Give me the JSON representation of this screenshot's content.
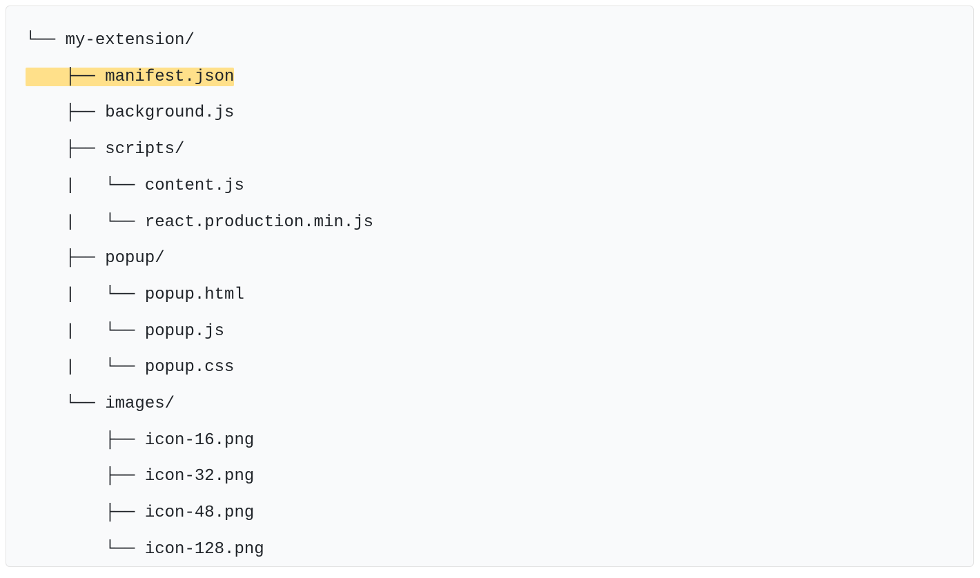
{
  "lines": [
    {
      "prefix": "└── ",
      "label": "my-extension/",
      "highlight": false
    },
    {
      "prefix": "    ├── ",
      "label": "manifest.json",
      "highlight": true
    },
    {
      "prefix": "    ├── ",
      "label": "background.js",
      "highlight": false
    },
    {
      "prefix": "    ├── ",
      "label": "scripts/",
      "highlight": false
    },
    {
      "prefix": "    |   └── ",
      "label": "content.js",
      "highlight": false
    },
    {
      "prefix": "    |   └── ",
      "label": "react.production.min.js",
      "highlight": false
    },
    {
      "prefix": "    ├── ",
      "label": "popup/",
      "highlight": false
    },
    {
      "prefix": "    |   └── ",
      "label": "popup.html",
      "highlight": false
    },
    {
      "prefix": "    |   └── ",
      "label": "popup.js",
      "highlight": false
    },
    {
      "prefix": "    |   └── ",
      "label": "popup.css",
      "highlight": false
    },
    {
      "prefix": "    └── ",
      "label": "images/",
      "highlight": false
    },
    {
      "prefix": "        ├── ",
      "label": "icon-16.png",
      "highlight": false
    },
    {
      "prefix": "        ├── ",
      "label": "icon-32.png",
      "highlight": false
    },
    {
      "prefix": "        ├── ",
      "label": "icon-48.png",
      "highlight": false
    },
    {
      "prefix": "        └── ",
      "label": "icon-128.png",
      "highlight": false
    }
  ]
}
